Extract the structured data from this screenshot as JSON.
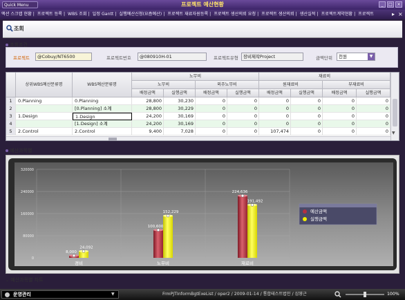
{
  "window": {
    "title": "프로젝트 예산현황",
    "quick_menu": "Quick Menu",
    "controls": [
      "_",
      "□",
      "×"
    ]
  },
  "menu": {
    "items": [
      "액션 스크랩 현황",
      "프로젝트 등록",
      "WBS 조회",
      "일정 Gantt",
      "실행예산신청(요즘예산)",
      "프로젝트 재료자원등록",
      "프로젝트 생산의뢰 요청",
      "프로젝트 생산의뢰",
      "생산실적",
      "프로젝트계약현황",
      "프로젝트"
    ]
  },
  "page": {
    "title": "조회"
  },
  "search": {
    "section_label": "조회조건",
    "project_label": "프로젝트",
    "project_value": "@Cobuy/NT6500",
    "project_no_label": "프로젝트번호",
    "project_no_value": "@080910H-01",
    "project_type_label": "프로젝트유형",
    "project_type_value": "장비제작Project",
    "unit_label": "금액단위",
    "unit_value": "천원"
  },
  "grid": {
    "headers": {
      "col_upper": "상위WBS예산분류명",
      "col_wbs": "WBS예산분류명",
      "grp_labor": "노무비",
      "grp_labor_sub1": "노무비",
      "grp_labor_sub2": "외주노무비",
      "grp_material": "재료비",
      "grp_material_sub1": "원재료비",
      "grp_material_sub2": "부재료비",
      "assign": "배정금액",
      "exec": "실행금액"
    },
    "rows": [
      {
        "no": "1",
        "upper": "0.Planning",
        "wbs": "0.Planning",
        "v": [
          "28,800",
          "30,230",
          "0",
          "0",
          "0",
          "0",
          "0",
          "0"
        ]
      },
      {
        "no": "2",
        "upper": "",
        "wbs": "[0.Planning] 소계",
        "v": [
          "28,800",
          "30,229",
          "0",
          "0",
          "0",
          "0",
          "0",
          "0"
        ]
      },
      {
        "no": "3",
        "upper": "1.Design",
        "wbs": "1.Design",
        "v": [
          "24,200",
          "30,169",
          "0",
          "0",
          "0",
          "0",
          "0",
          "0"
        ]
      },
      {
        "no": "4",
        "upper": "",
        "wbs": "[1.Design] 소계",
        "v": [
          "24,200",
          "30,169",
          "0",
          "0",
          "0",
          "0",
          "0",
          "0"
        ]
      },
      {
        "no": "5",
        "upper": "2.Control",
        "wbs": "2.Control",
        "v": [
          "9,400",
          "7,028",
          "0",
          "0",
          "107,474",
          "0",
          "0",
          "0"
        ]
      }
    ]
  },
  "chart_section": {
    "label": "예산과목별",
    "bottom_tab": "예산과목별 차트"
  },
  "chart_data": {
    "type": "bar",
    "categories": [
      "경비",
      "노무비",
      "재료비"
    ],
    "series": [
      {
        "name": "예산금액",
        "values": [
          8000,
          100600,
          224636
        ]
      },
      {
        "name": "실행금액",
        "values": [
          24092,
          152229,
          191492
        ]
      }
    ],
    "data_labels": [
      [
        "8,000",
        "100,600",
        "224,636"
      ],
      [
        "24,092",
        "152,229",
        "191,492"
      ]
    ],
    "y_ticks": [
      "320000",
      "240000",
      "160000",
      "80000",
      "0"
    ],
    "ylim": [
      0,
      320000
    ],
    "legend_position": "right",
    "colors": {
      "series1": "#b43040",
      "series2": "#f2f000"
    }
  },
  "status": {
    "module": "운영관리",
    "info": "FrmPJTInformBgtExeList / oper2 / 2009-01-14 / 통합테스트법인 / 심영근",
    "zoom": "100%"
  },
  "colors": {
    "titlebar": "#4a2f78",
    "accent": "#ffe36a",
    "subtotal_row": "#e9f8ea"
  }
}
